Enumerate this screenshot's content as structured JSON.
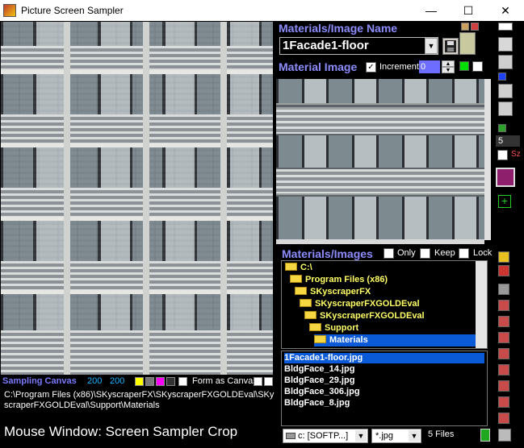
{
  "window": {
    "title": "Picture Screen Sampler",
    "minimize": "—",
    "maximize": "☐",
    "close": "✕"
  },
  "materials": {
    "header": "Materials/Image Name",
    "selected_name": "1Facade1-floor",
    "image_header": "Material Image",
    "increment_label": "Increment",
    "increment_value": "0",
    "list_header": "Materials/Images",
    "only_label": "Only",
    "keep_label": "Keep",
    "lock_label": "Lock"
  },
  "sampling": {
    "label": "Sampling Canvas",
    "width": "200",
    "height": "200",
    "form_as_canvas": "Form as Canvas"
  },
  "path_text": "C:\\Program Files (x86)\\SKyscraperFX\\SKyscraperFXGOLDEval\\SKyscraperFXGOLDEval\\Support\\Materials",
  "mouse_window": "Mouse Window: Screen Sampler Crop",
  "side": {
    "size_value": "5",
    "size_label": "Sz"
  },
  "tree": [
    {
      "label": "C:\\",
      "indent": 0
    },
    {
      "label": "Program Files (x86)",
      "indent": 1
    },
    {
      "label": "SKyscraperFX",
      "indent": 2
    },
    {
      "label": "SKyscraperFXGOLDEval",
      "indent": 3
    },
    {
      "label": "SKyscraperFXGOLDEval",
      "indent": 4
    },
    {
      "label": "Support",
      "indent": 5
    },
    {
      "label": "Materials",
      "indent": 6,
      "selected": true
    }
  ],
  "files": [
    {
      "name": "1Facade1-floor.jpg",
      "selected": true
    },
    {
      "name": "BldgFace_14.jpg"
    },
    {
      "name": "BldgFace_29.jpg"
    },
    {
      "name": "BldgFace_306.jpg"
    },
    {
      "name": "BldgFace_8.jpg"
    }
  ],
  "drive_select": "c: [SOFTP...]",
  "ext_select": "*.jpg",
  "file_count": "5 Files",
  "colors": {
    "accent": "#8c8cff",
    "selection": "#0a5ad8",
    "folder_text": "#ffff66"
  },
  "icons": [
    "app-icon",
    "save-icon",
    "dropdown-arrow-icon",
    "spinner-up-icon",
    "spinner-down-icon",
    "folder-icon",
    "paint-brush-icon",
    "plus-icon",
    "copy-icon",
    "paste-icon",
    "drive-icon"
  ]
}
